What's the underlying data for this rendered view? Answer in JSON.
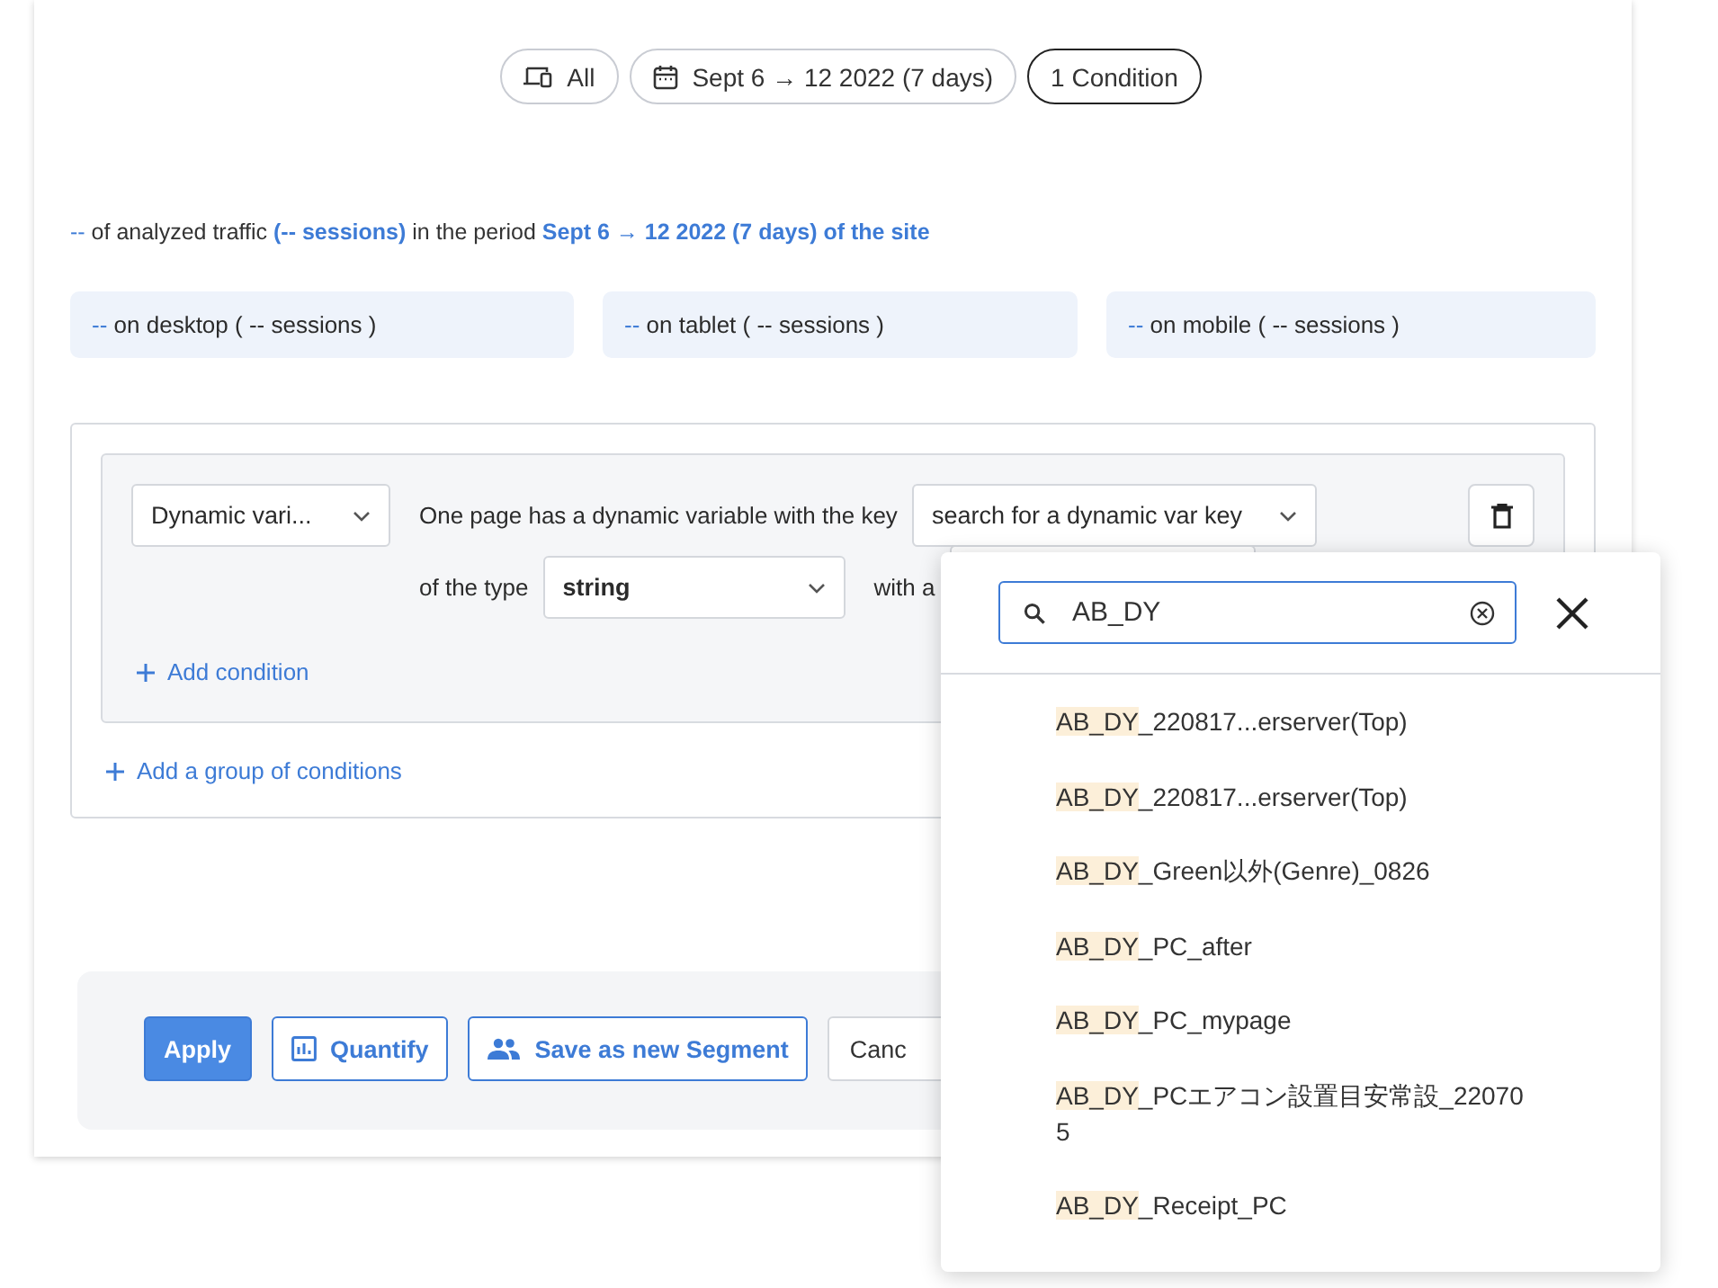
{
  "filters": [
    {
      "kind": "device",
      "label": "All",
      "selected": false
    },
    {
      "kind": "date",
      "label": "Sept 6 → 12 2022 (7 days)",
      "selected": false
    },
    {
      "kind": "plain",
      "label": "1 Condition",
      "selected": true
    }
  ],
  "summary": [
    {
      "text": "--",
      "kind": "accent"
    },
    {
      "text": " of analyzed traffic ",
      "kind": "plain"
    },
    {
      "text": "(-- sessions)",
      "kind": "strong"
    },
    {
      "text": " in the period ",
      "kind": "plain"
    },
    {
      "text": "Sept 6 → 12 2022 (7 days) of the site",
      "kind": "strong"
    }
  ],
  "devices": [
    {
      "value": "--",
      "label": "on desktop ( -- sessions )"
    },
    {
      "value": "--",
      "label": "on tablet ( -- sessions )"
    },
    {
      "value": "--",
      "label": "on mobile ( -- sessions )"
    }
  ],
  "condition": {
    "criterion": "Dynamic vari...",
    "text_1": "One page has a dynamic variable with the key",
    "key_placeholder": "search for a dynamic var key",
    "text_2": "of the type",
    "type": "string",
    "text_3": "with a",
    "add_condition": "Add condition"
  },
  "add_group": "Add a group of conditions",
  "actions": [
    {
      "kind": "primary",
      "label": "Apply"
    },
    {
      "kind": "chart",
      "label": "Quantify"
    },
    {
      "kind": "people",
      "label": "Save as new Segment"
    },
    {
      "kind": "plain",
      "label": "Canc"
    }
  ],
  "popup": {
    "search": "AB_DY",
    "results": [
      {
        "match": "AB_DY",
        "rest": "_220817...erserver(Top)"
      },
      {
        "match": "AB_DY",
        "rest": "_220817...erserver(Top)"
      },
      {
        "match": "AB_DY",
        "rest": "_Green以外(Genre)_0826"
      },
      {
        "match": "AB_DY",
        "rest": "_PC_after"
      },
      {
        "match": "AB_DY",
        "rest": "_PC_mypage"
      },
      {
        "match": "AB_DY",
        "rest": "_PCエアコン設置目安常設_220705"
      },
      {
        "match": "AB_DY",
        "rest": "_Receipt_PC"
      }
    ]
  }
}
